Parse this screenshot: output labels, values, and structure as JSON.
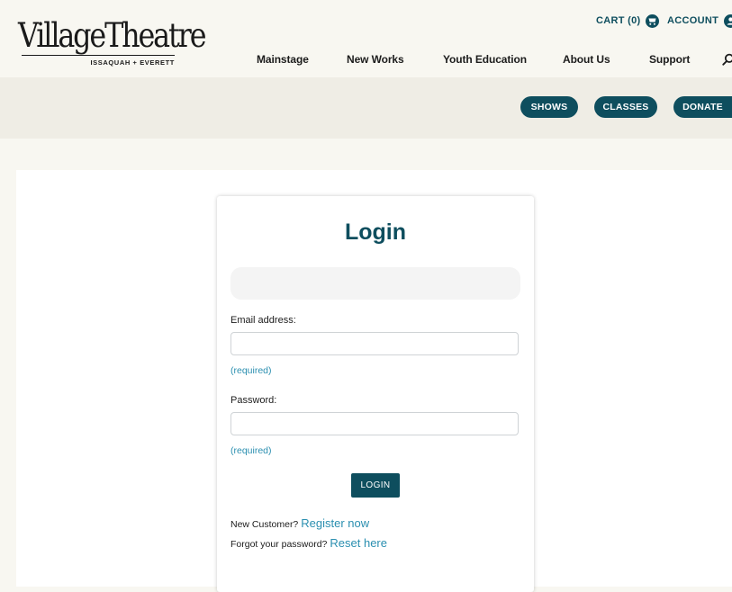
{
  "header": {
    "logo": {
      "wordmark": "VillageTheatre",
      "subtitle": "ISSAQUAH + EVERETT"
    },
    "cart_label": "CART (0)",
    "account_label": "ACCOUNT",
    "nav": [
      "Mainstage",
      "New Works",
      "Youth Education",
      "About Us",
      "Support"
    ]
  },
  "actions": {
    "shows": "SHOWS",
    "classes": "CLASSES",
    "donate": "DONATE"
  },
  "login": {
    "title": "Login",
    "email_label": "Email address:",
    "email_value": "",
    "email_required": "(required)",
    "password_label": "Password:",
    "password_value": "",
    "password_required": "(required)",
    "button": "LOGIN",
    "new_customer_prefix": "New Customer?",
    "register_link": "Register now",
    "forgot_prefix": "Forgot your password?",
    "reset_link": "Reset here"
  },
  "colors": {
    "brand": "#0e4e5e",
    "link": "#2b8fb0",
    "background": "#f8f7f1"
  }
}
